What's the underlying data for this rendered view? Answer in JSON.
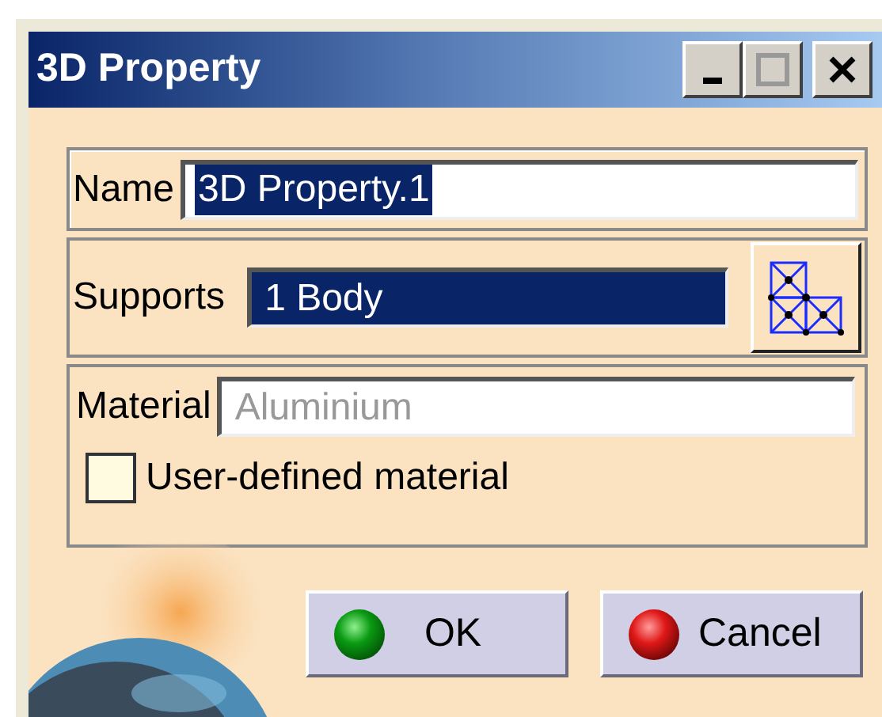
{
  "window": {
    "title": "3D Property"
  },
  "name_field": {
    "label": "Name",
    "value": "3D Property.1",
    "selected": true
  },
  "supports_field": {
    "label": "Supports",
    "value": "1 Body",
    "selected": true
  },
  "material_field": {
    "label": "Material",
    "value": "Aluminium",
    "disabled": true
  },
  "user_defined_material": {
    "label": "User-defined material",
    "checked": false
  },
  "buttons": [
    {
      "label": "OK",
      "kind": "ok"
    },
    {
      "label": "Cancel",
      "kind": "cancel"
    }
  ]
}
